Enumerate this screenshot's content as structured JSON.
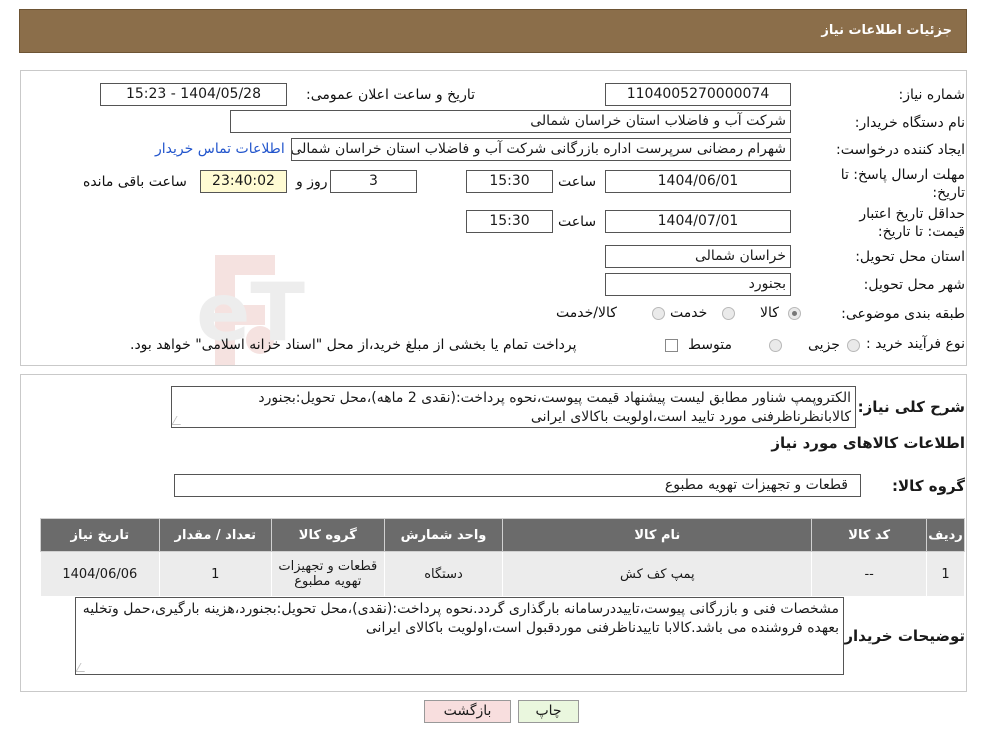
{
  "header": {
    "title": "جزئیات اطلاعات نیاز"
  },
  "fields": {
    "need_number_label": "شماره نیاز:",
    "need_number": "1104005270000074",
    "announce_label": "تاریخ و ساعت اعلان عمومی:",
    "announce_value": "1404/05/28 - 15:23",
    "buyer_org_label": "نام دستگاه خریدار:",
    "buyer_org": "شرکت آب و فاضلاب استان خراسان شمالی",
    "creator_label": "ایجاد کننده درخواست:",
    "creator": "شهرام رمضانی سرپرست اداره بازرگانی  شرکت آب و فاضلاب استان خراسان شمالی",
    "contact_link": "اطلاعات تماس خریدار",
    "reply_deadline_label": "مهلت ارسال پاسخ: تا تاریخ:",
    "reply_date": "1404/06/01",
    "time_label": "ساعت",
    "reply_time": "15:30",
    "days_value": "3",
    "days_label": "روز و",
    "remaining_value": "23:40:02",
    "remaining_label": "ساعت باقی مانده",
    "validity_label": "حداقل تاریخ اعتبار قیمت: تا تاریخ:",
    "validity_date": "1404/07/01",
    "validity_time": "15:30",
    "province_label": "استان محل تحویل:",
    "province": "خراسان شمالی",
    "city_label": "شهر محل تحویل:",
    "city": "بجنورد",
    "category_label": "طبقه بندی موضوعی:",
    "category_options": [
      "کالا",
      "خدمت",
      "کالا/خدمت"
    ],
    "process_label": "نوع فرآیند خرید :",
    "process_options": [
      "جزیی",
      "متوسط"
    ],
    "payment_note": "پرداخت تمام یا بخشی از مبلغ خرید،از محل \"اسناد خزانه اسلامی\" خواهد بود."
  },
  "summary": {
    "label": "شرح کلی نیاز:",
    "text": "الکتروپمپ شناور مطابق لیست پیشنهاد قیمت پیوست،نحوه پرداخت:(نقدی 2 ماهه)،محل تحویل:بجنورد کالابانظرناظرفنی مورد تایید است،اولویت باکالای ایرانی"
  },
  "goods_section": {
    "title": "اطلاعات کالاهای مورد نیاز",
    "group_label": "گروه کالا:",
    "group_value": "قطعات و تجهیزات تهویه مطبوع"
  },
  "table": {
    "headers": [
      "ردیف",
      "کد کالا",
      "نام کالا",
      "واحد شمارش",
      "گروه کالا",
      "تعداد / مقدار",
      "تاریخ نیاز"
    ],
    "rows": [
      [
        "1",
        "--",
        "پمپ کف کش",
        "دستگاه",
        "قطعات و تجهیزات تهویه مطبوع",
        "1",
        "1404/06/06"
      ]
    ]
  },
  "buyer_notes": {
    "label": "توضیحات خریدار:",
    "text": "مشخصات فنی و بازرگانی پیوست،تاییددرسامانه بارگذاری گردد.نحوه پرداخت:(نقدی)،محل تحویل:بجنورد،هزینه بارگیری،حمل وتخلیه بعهده فروشنده می باشد.کالابا تاییدناظرفنی موردقبول است،اولویت باکالای ایرانی"
  },
  "buttons": {
    "print": "چاپ",
    "back": "بازگشت"
  },
  "watermark": {
    "text": "AriaTender.neT"
  },
  "colors": {
    "header": "#8b6e4a",
    "table_header": "#6b6b6b",
    "link": "#2255cc",
    "back_button": "#f8dede",
    "print_button": "#eaf7de"
  }
}
